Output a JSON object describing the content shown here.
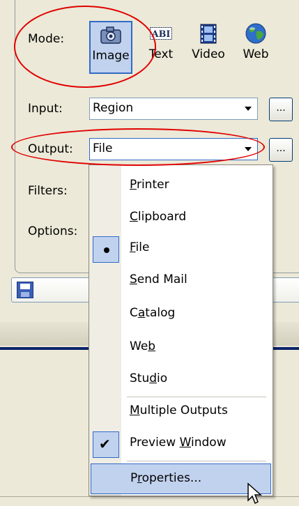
{
  "mode": {
    "label": "Mode:",
    "buttons": [
      {
        "label": "Image",
        "icon": "camera-icon",
        "selected": true
      },
      {
        "label": "Text",
        "icon": "text-abc-icon",
        "selected": false
      },
      {
        "label": "Video",
        "icon": "film-icon",
        "selected": false
      },
      {
        "label": "Web",
        "icon": "globe-icon",
        "selected": false
      }
    ]
  },
  "input": {
    "label": "Input:",
    "value": "Region",
    "browse_label": "..."
  },
  "output": {
    "label": "Output:",
    "value": "File",
    "browse_label": "..."
  },
  "filters_label": "Filters:",
  "options_label": "Options:",
  "output_menu": {
    "items": [
      {
        "label": "Printer",
        "accel": "P",
        "rest": "rinter"
      },
      {
        "label": "Clipboard",
        "accel": "C",
        "rest": "lipboard"
      },
      {
        "label": "File",
        "accel": "F",
        "rest": "ile",
        "bullet": true
      },
      {
        "label": "Send Mail",
        "accel": "S",
        "rest": "end Mail"
      },
      {
        "label": "Catalog",
        "pre": "C",
        "accel": "a",
        "rest": "talog"
      },
      {
        "label": "Web",
        "pre": "We",
        "accel": "b",
        "rest": ""
      },
      {
        "label": "Studio",
        "pre": "Stu",
        "accel": "d",
        "rest": "io"
      },
      {
        "label": "Multiple Outputs",
        "accel": "M",
        "rest": "ultiple Outputs"
      },
      {
        "label": "Preview Window",
        "pre": "Preview ",
        "accel": "W",
        "rest": "indow",
        "checked": true
      },
      {
        "label": "Properties...",
        "pre": "P",
        "accel": "r",
        "rest": "operties..."
      }
    ]
  },
  "colors": {
    "highlight": "#c1d2ee",
    "highlight_border": "#316ac5",
    "annotation": "#e10000"
  }
}
